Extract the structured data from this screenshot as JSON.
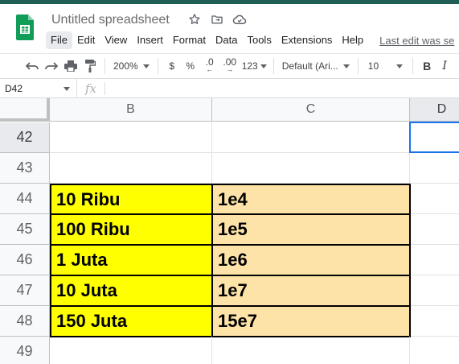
{
  "app": {
    "doc_title": "Untitled spreadsheet",
    "brand_color": "#0f9d58"
  },
  "menu": {
    "items": [
      "File",
      "Edit",
      "View",
      "Insert",
      "Format",
      "Data",
      "Tools",
      "Extensions",
      "Help"
    ],
    "active": "File",
    "last_edit": "Last edit was se"
  },
  "toolbar": {
    "zoom": "200%",
    "currency": "$",
    "percent": "%",
    "dec_decrease": ".0",
    "dec_increase": ".00",
    "more_formats": "123",
    "font": "Default (Ari...",
    "font_size": "10",
    "bold": "B",
    "italic": "I"
  },
  "formula_bar": {
    "cell_ref": "D42",
    "fx": "fx",
    "value": ""
  },
  "sheet": {
    "columns": [
      "B",
      "C",
      "D"
    ],
    "rows": [
      {
        "num": "42",
        "b": "",
        "c": ""
      },
      {
        "num": "43",
        "b": "",
        "c": ""
      },
      {
        "num": "44",
        "b": "10 Ribu",
        "c": "1e4"
      },
      {
        "num": "45",
        "b": "100 Ribu",
        "c": "1e5"
      },
      {
        "num": "46",
        "b": "1 Juta",
        "c": "1e6"
      },
      {
        "num": "47",
        "b": "10 Juta",
        "c": "1e7"
      },
      {
        "num": "48",
        "b": "150 Juta",
        "c": "15e7"
      },
      {
        "num": "49",
        "b": "",
        "c": ""
      }
    ],
    "selected_cell": "D42",
    "fill_b": "#ffff00",
    "fill_c": "#fde3a8"
  }
}
